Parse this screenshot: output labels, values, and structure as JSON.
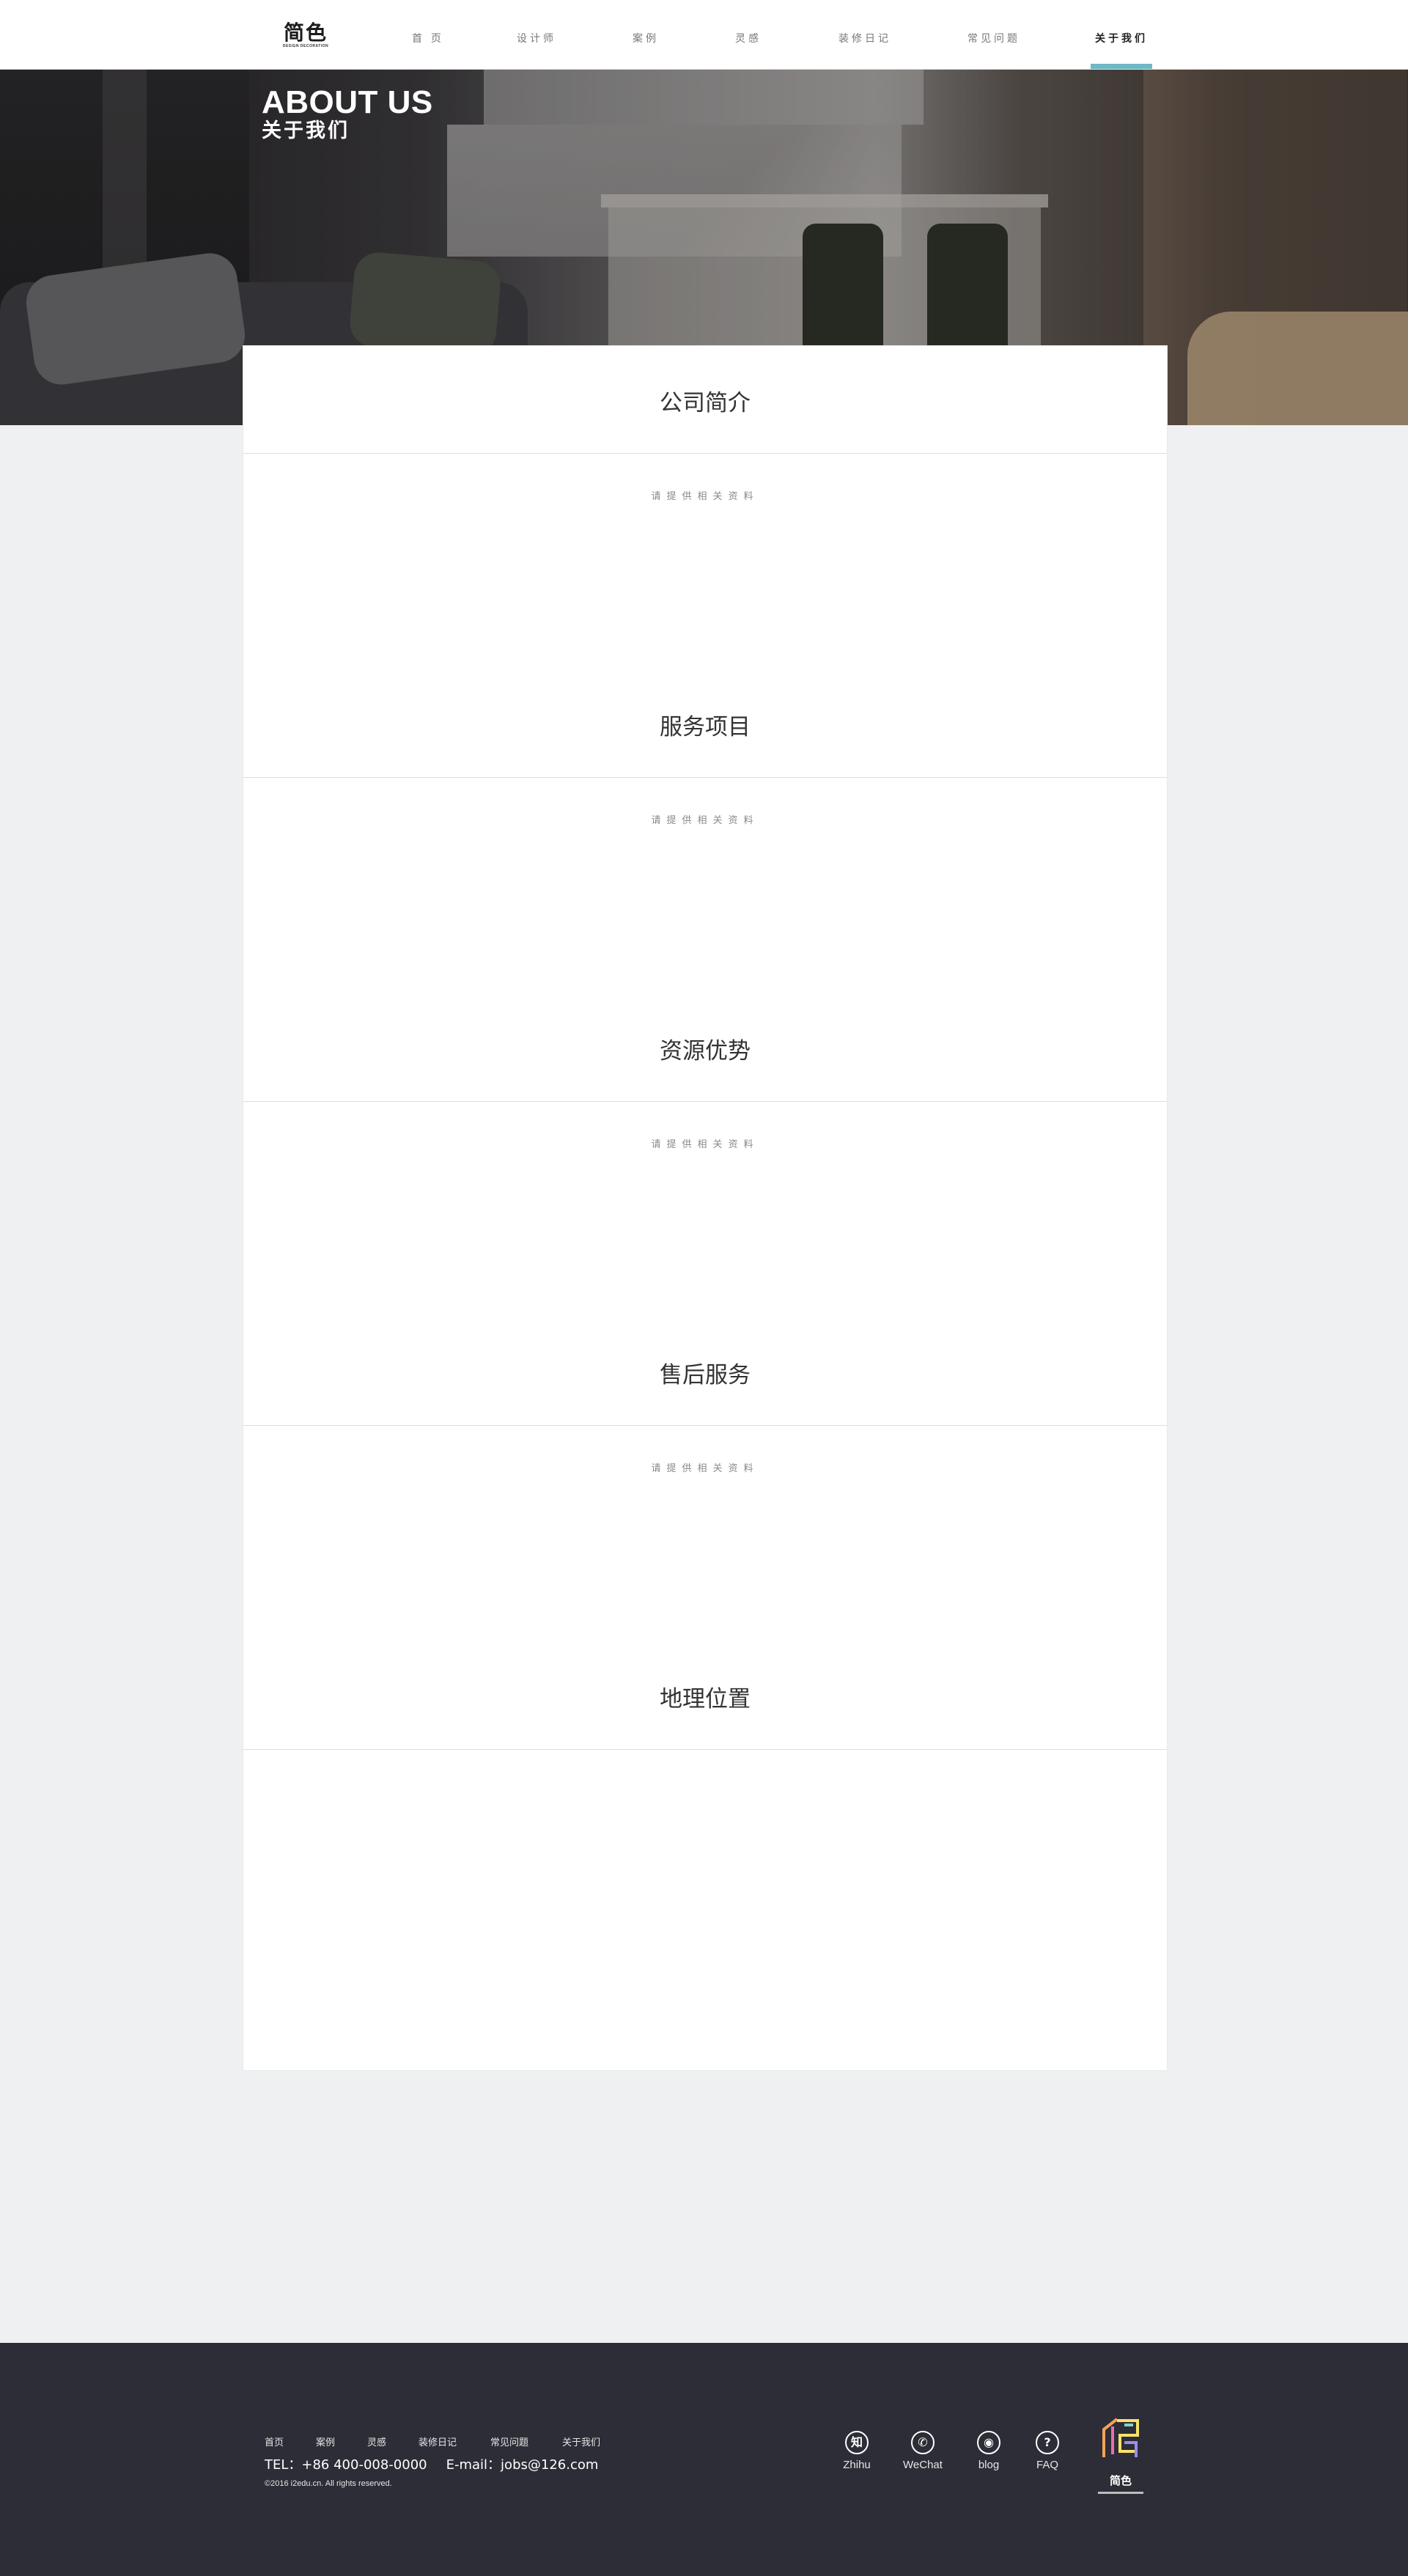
{
  "header": {
    "logo": {
      "mark": "简色",
      "sub": "DESIGN DECORATION"
    },
    "nav": [
      {
        "label": "首 页",
        "active": false
      },
      {
        "label": "设计师",
        "active": false
      },
      {
        "label": "案例",
        "active": false
      },
      {
        "label": "灵感",
        "active": false
      },
      {
        "label": "装修日记",
        "active": false
      },
      {
        "label": "常见问题",
        "active": false
      },
      {
        "label": "关于我们",
        "active": true
      }
    ],
    "active_color": "#6fb8c4"
  },
  "hero": {
    "title": "ABOUT US",
    "subtitle": "关于我们"
  },
  "sections": [
    {
      "title": "公司简介",
      "note": "请提供相关资料"
    },
    {
      "title": "服务项目",
      "note": "请提供相关资料"
    },
    {
      "title": "资源优势",
      "note": "请提供相关资料"
    },
    {
      "title": "售后服务",
      "note": "请提供相关资料"
    },
    {
      "title": "地理位置",
      "note": ""
    }
  ],
  "footer": {
    "links": [
      "首页",
      "案例",
      "灵感",
      "装修日记",
      "常见问题",
      "关于我们"
    ],
    "tel": "TEL：+86 400-008-0000",
    "email": "E-mail：jobs@126.com",
    "copyright": "©2016 i2edu.cn. All rights reserved.",
    "social": [
      {
        "label": "Zhihu",
        "glyph": "知",
        "icon": "zhihu-icon"
      },
      {
        "label": "WeChat",
        "glyph": "✆",
        "icon": "wechat-icon"
      },
      {
        "label": "blog",
        "glyph": "◉",
        "icon": "weibo-icon"
      },
      {
        "label": "FAQ",
        "glyph": "?",
        "icon": "faq-icon"
      }
    ],
    "logo_mark": "简色",
    "background": "#2c2d36"
  }
}
